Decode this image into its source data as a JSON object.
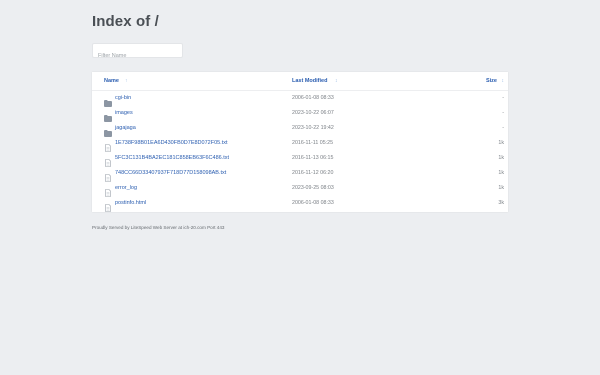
{
  "page": {
    "title": "Index of /"
  },
  "filter": {
    "placeholder": "Filter Name",
    "value": ""
  },
  "table": {
    "headers": {
      "name": "Name",
      "modified": "Last Modified",
      "size": "Size"
    },
    "sort_indicators": {
      "name": "↑",
      "modified": "↕",
      "size": "↕"
    },
    "rows": [
      {
        "type": "folder-icon",
        "name": "cgi-bin",
        "modified": "2006-01-08 08:33",
        "size": "-"
      },
      {
        "type": "folder-icon",
        "name": "images",
        "modified": "2023-10-22 06:07",
        "size": "-"
      },
      {
        "type": "folder-icon",
        "name": "jagajaga",
        "modified": "2023-10-22 19:42",
        "size": "-"
      },
      {
        "type": "file-icon",
        "name": "1E738F98B01EA6D430FB0D7E8D072F05.txt",
        "modified": "2016-11-11 05:25",
        "size": "1k"
      },
      {
        "type": "file-icon",
        "name": "5FC3C131B4BA2EC181C858EB63F6C486.txt",
        "modified": "2016-11-13 06:15",
        "size": "1k"
      },
      {
        "type": "file-icon",
        "name": "748CC66D33407937F718D77D158098AB.txt",
        "modified": "2016-11-12 06:20",
        "size": "1k"
      },
      {
        "type": "file-icon",
        "name": "error_log",
        "modified": "2023-09-25 08:03",
        "size": "1k"
      },
      {
        "type": "file-icon",
        "name": "postinfo.html",
        "modified": "2006-01-08 08:33",
        "size": "3k"
      }
    ]
  },
  "footer": {
    "text": "Proudly Served by LiteSpeed Web Server at ich-20.com Port 443"
  },
  "colors": {
    "link": "#2a5db0",
    "folder": "#8c96a3",
    "background": "#eceef1"
  }
}
